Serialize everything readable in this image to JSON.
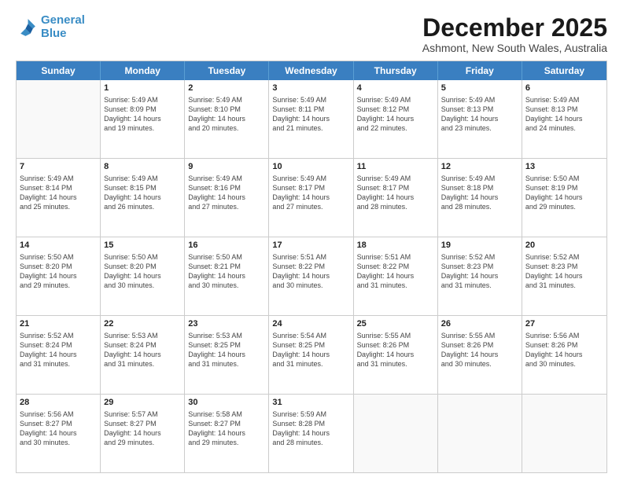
{
  "logo": {
    "line1": "General",
    "line2": "Blue"
  },
  "title": "December 2025",
  "subtitle": "Ashmont, New South Wales, Australia",
  "header_days": [
    "Sunday",
    "Monday",
    "Tuesday",
    "Wednesday",
    "Thursday",
    "Friday",
    "Saturday"
  ],
  "weeks": [
    [
      {
        "day": "",
        "info": ""
      },
      {
        "day": "1",
        "info": "Sunrise: 5:49 AM\nSunset: 8:09 PM\nDaylight: 14 hours\nand 19 minutes."
      },
      {
        "day": "2",
        "info": "Sunrise: 5:49 AM\nSunset: 8:10 PM\nDaylight: 14 hours\nand 20 minutes."
      },
      {
        "day": "3",
        "info": "Sunrise: 5:49 AM\nSunset: 8:11 PM\nDaylight: 14 hours\nand 21 minutes."
      },
      {
        "day": "4",
        "info": "Sunrise: 5:49 AM\nSunset: 8:12 PM\nDaylight: 14 hours\nand 22 minutes."
      },
      {
        "day": "5",
        "info": "Sunrise: 5:49 AM\nSunset: 8:13 PM\nDaylight: 14 hours\nand 23 minutes."
      },
      {
        "day": "6",
        "info": "Sunrise: 5:49 AM\nSunset: 8:13 PM\nDaylight: 14 hours\nand 24 minutes."
      }
    ],
    [
      {
        "day": "7",
        "info": "Sunrise: 5:49 AM\nSunset: 8:14 PM\nDaylight: 14 hours\nand 25 minutes."
      },
      {
        "day": "8",
        "info": "Sunrise: 5:49 AM\nSunset: 8:15 PM\nDaylight: 14 hours\nand 26 minutes."
      },
      {
        "day": "9",
        "info": "Sunrise: 5:49 AM\nSunset: 8:16 PM\nDaylight: 14 hours\nand 27 minutes."
      },
      {
        "day": "10",
        "info": "Sunrise: 5:49 AM\nSunset: 8:17 PM\nDaylight: 14 hours\nand 27 minutes."
      },
      {
        "day": "11",
        "info": "Sunrise: 5:49 AM\nSunset: 8:17 PM\nDaylight: 14 hours\nand 28 minutes."
      },
      {
        "day": "12",
        "info": "Sunrise: 5:49 AM\nSunset: 8:18 PM\nDaylight: 14 hours\nand 28 minutes."
      },
      {
        "day": "13",
        "info": "Sunrise: 5:50 AM\nSunset: 8:19 PM\nDaylight: 14 hours\nand 29 minutes."
      }
    ],
    [
      {
        "day": "14",
        "info": "Sunrise: 5:50 AM\nSunset: 8:20 PM\nDaylight: 14 hours\nand 29 minutes."
      },
      {
        "day": "15",
        "info": "Sunrise: 5:50 AM\nSunset: 8:20 PM\nDaylight: 14 hours\nand 30 minutes."
      },
      {
        "day": "16",
        "info": "Sunrise: 5:50 AM\nSunset: 8:21 PM\nDaylight: 14 hours\nand 30 minutes."
      },
      {
        "day": "17",
        "info": "Sunrise: 5:51 AM\nSunset: 8:22 PM\nDaylight: 14 hours\nand 30 minutes."
      },
      {
        "day": "18",
        "info": "Sunrise: 5:51 AM\nSunset: 8:22 PM\nDaylight: 14 hours\nand 31 minutes."
      },
      {
        "day": "19",
        "info": "Sunrise: 5:52 AM\nSunset: 8:23 PM\nDaylight: 14 hours\nand 31 minutes."
      },
      {
        "day": "20",
        "info": "Sunrise: 5:52 AM\nSunset: 8:23 PM\nDaylight: 14 hours\nand 31 minutes."
      }
    ],
    [
      {
        "day": "21",
        "info": "Sunrise: 5:52 AM\nSunset: 8:24 PM\nDaylight: 14 hours\nand 31 minutes."
      },
      {
        "day": "22",
        "info": "Sunrise: 5:53 AM\nSunset: 8:24 PM\nDaylight: 14 hours\nand 31 minutes."
      },
      {
        "day": "23",
        "info": "Sunrise: 5:53 AM\nSunset: 8:25 PM\nDaylight: 14 hours\nand 31 minutes."
      },
      {
        "day": "24",
        "info": "Sunrise: 5:54 AM\nSunset: 8:25 PM\nDaylight: 14 hours\nand 31 minutes."
      },
      {
        "day": "25",
        "info": "Sunrise: 5:55 AM\nSunset: 8:26 PM\nDaylight: 14 hours\nand 31 minutes."
      },
      {
        "day": "26",
        "info": "Sunrise: 5:55 AM\nSunset: 8:26 PM\nDaylight: 14 hours\nand 30 minutes."
      },
      {
        "day": "27",
        "info": "Sunrise: 5:56 AM\nSunset: 8:26 PM\nDaylight: 14 hours\nand 30 minutes."
      }
    ],
    [
      {
        "day": "28",
        "info": "Sunrise: 5:56 AM\nSunset: 8:27 PM\nDaylight: 14 hours\nand 30 minutes."
      },
      {
        "day": "29",
        "info": "Sunrise: 5:57 AM\nSunset: 8:27 PM\nDaylight: 14 hours\nand 29 minutes."
      },
      {
        "day": "30",
        "info": "Sunrise: 5:58 AM\nSunset: 8:27 PM\nDaylight: 14 hours\nand 29 minutes."
      },
      {
        "day": "31",
        "info": "Sunrise: 5:59 AM\nSunset: 8:28 PM\nDaylight: 14 hours\nand 28 minutes."
      },
      {
        "day": "",
        "info": ""
      },
      {
        "day": "",
        "info": ""
      },
      {
        "day": "",
        "info": ""
      }
    ]
  ]
}
